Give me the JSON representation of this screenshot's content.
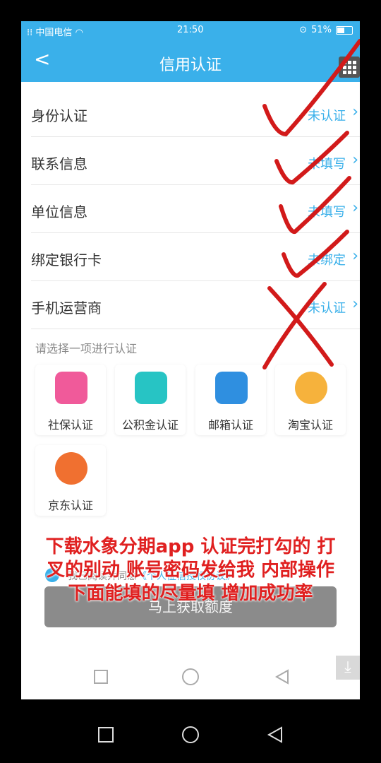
{
  "status_bar": {
    "carrier": "中国电信",
    "time": "21:50",
    "battery": "51%",
    "battery_level": 0.51
  },
  "header": {
    "title": "信用认证",
    "back_icon": "back-chevron-icon",
    "menu_icon": "grid-menu-icon"
  },
  "items": [
    {
      "label": "身份认证",
      "status": "未认证"
    },
    {
      "label": "联系信息",
      "status": "未填写"
    },
    {
      "label": "单位信息",
      "status": "未填写"
    },
    {
      "label": "绑定银行卡",
      "status": "未绑定"
    },
    {
      "label": "手机运营商",
      "status": "未认证"
    }
  ],
  "hint": "请选择一项进行认证",
  "options": [
    {
      "label": "社保认证",
      "icon": "social-security-icon",
      "color": "#f05a9a"
    },
    {
      "label": "公积金认证",
      "icon": "provident-fund-icon",
      "color": "#27c4c4"
    },
    {
      "label": "邮箱认证",
      "icon": "mail-icon",
      "color": "#2f8fe0"
    },
    {
      "label": "淘宝认证",
      "icon": "taobao-icon",
      "color": "#f6b23c"
    },
    {
      "label": "京东认证",
      "icon": "jd-icon",
      "color": "#f07030"
    }
  ],
  "agreement": {
    "prefix": "我已阅读并同意",
    "link": "《个人征信授权协议》"
  },
  "submit_label": "马上获取额度",
  "overlay_text": [
    "下载水象分期app 认证完打勾的 打",
    "叉的别动 账号密码发给我 内部操作",
    "下面能填的尽量填 增加成功率"
  ],
  "colors": {
    "accent": "#3ab0ea",
    "annotation": "#e02020"
  }
}
